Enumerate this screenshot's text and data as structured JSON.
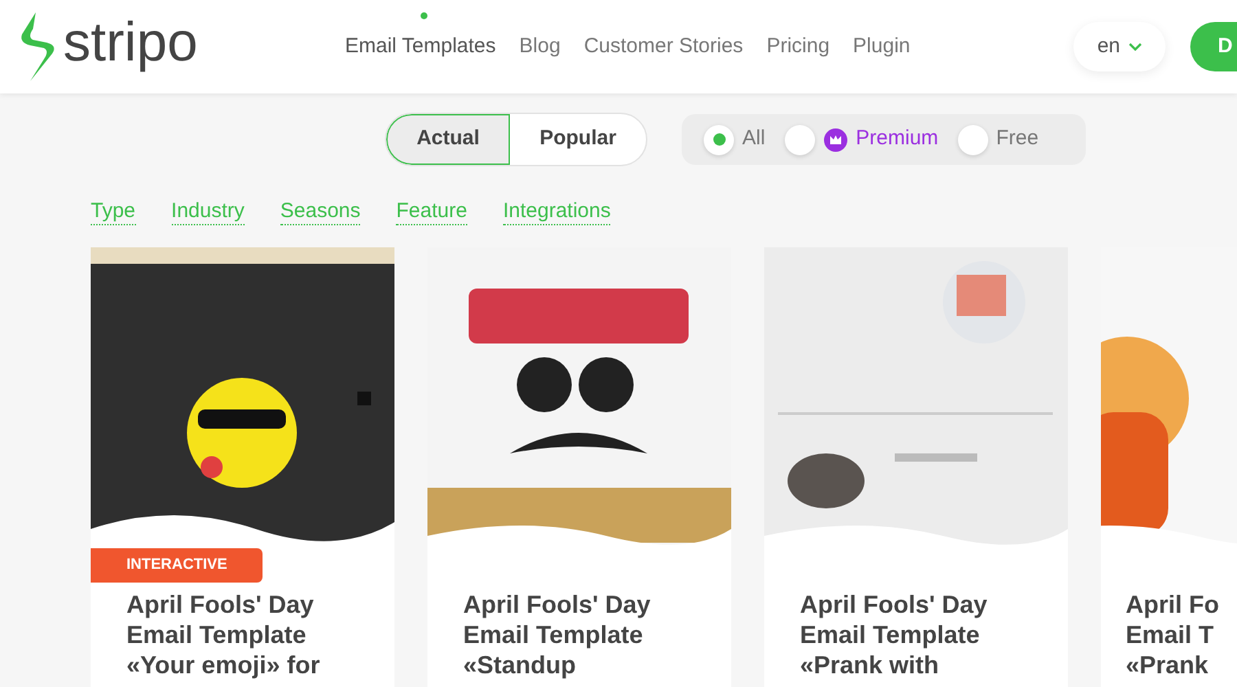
{
  "header": {
    "logo": "stripo",
    "nav": [
      {
        "label": "Email Templates",
        "selected": true
      },
      {
        "label": "Blog",
        "selected": false
      },
      {
        "label": "Customer Stories",
        "selected": false
      },
      {
        "label": "Pricing",
        "selected": false
      },
      {
        "label": "Plugin",
        "selected": false
      }
    ],
    "language": "en",
    "cta": "D"
  },
  "sort_tabs": [
    {
      "label": "Actual",
      "selected": true
    },
    {
      "label": "Popular",
      "selected": false
    }
  ],
  "price_filter": [
    {
      "label": "All",
      "kind": "plain",
      "selected": true
    },
    {
      "label": "Premium",
      "kind": "premium",
      "selected": false
    },
    {
      "label": "Free",
      "kind": "plain",
      "selected": false
    }
  ],
  "filters": [
    "Type",
    "Industry",
    "Seasons",
    "Feature",
    "Integrations"
  ],
  "cards": [
    {
      "badge": "INTERACTIVE",
      "title_lines": [
        "April Fools' Day",
        "Email Template",
        "«Your emoji» for"
      ]
    },
    {
      "title_lines": [
        "April Fools' Day",
        "Email Template",
        "«Standup"
      ]
    },
    {
      "title_lines": [
        "April Fools' Day",
        "Email Template",
        "«Prank with"
      ]
    },
    {
      "title_lines": [
        "April Fo",
        "Email T",
        "«Prank"
      ]
    }
  ]
}
